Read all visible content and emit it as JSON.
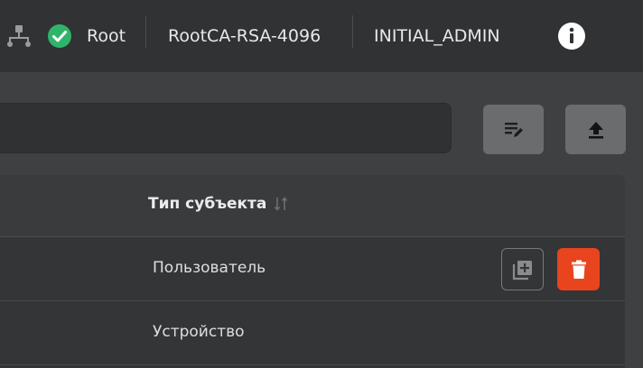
{
  "header": {
    "status_label": "Root",
    "ca_name": "RootCA-RSA-4096",
    "user_name": "INITIAL_ADMIN"
  },
  "table": {
    "columns": [
      {
        "label": "Тип субъекта"
      }
    ],
    "rows": [
      {
        "subject_type": "Пользователь"
      },
      {
        "subject_type": "Устройство"
      }
    ]
  },
  "icons": {
    "hierarchy": "hierarchy-icon",
    "status": "check-circle-icon",
    "info": "info-icon",
    "edit_list": "edit-list-icon",
    "upload": "upload-icon",
    "sort": "sort-icon",
    "add": "add-copy-icon",
    "delete": "trash-icon"
  },
  "colors": {
    "status_ok": "#2fb56b",
    "delete_button": "#e8441e",
    "topbar_bg": "#313234",
    "content_bg": "#3f4042"
  }
}
